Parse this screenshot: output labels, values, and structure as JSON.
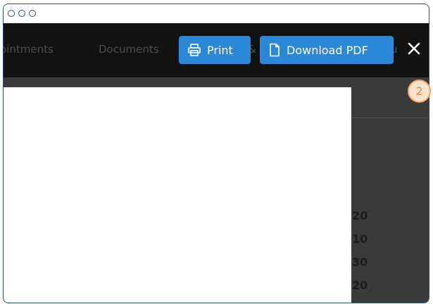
{
  "window": {
    "controls": [
      "window-dot",
      "window-dot",
      "window-dot"
    ]
  },
  "nav": {
    "tab_appointments": "ointments",
    "tab_documents": "Documents",
    "tab_fragment": "&",
    "tab_fragment2": "u"
  },
  "toolbar": {
    "print_label": "Print",
    "download_label": "Download PDF",
    "print_icon": "printer-icon",
    "download_icon": "document-icon",
    "close_icon": "close-icon"
  },
  "preview": {
    "values": [
      "20",
      "10",
      "30",
      "20"
    ]
  },
  "callout": {
    "step": "2"
  },
  "colors": {
    "topbar": "#121212",
    "button": "#2b88d8",
    "preview_bg": "#3a3a3a",
    "callout_border": "#f4a460",
    "callout_fill": "#fbe4d1",
    "callout_text": "#f08030"
  }
}
